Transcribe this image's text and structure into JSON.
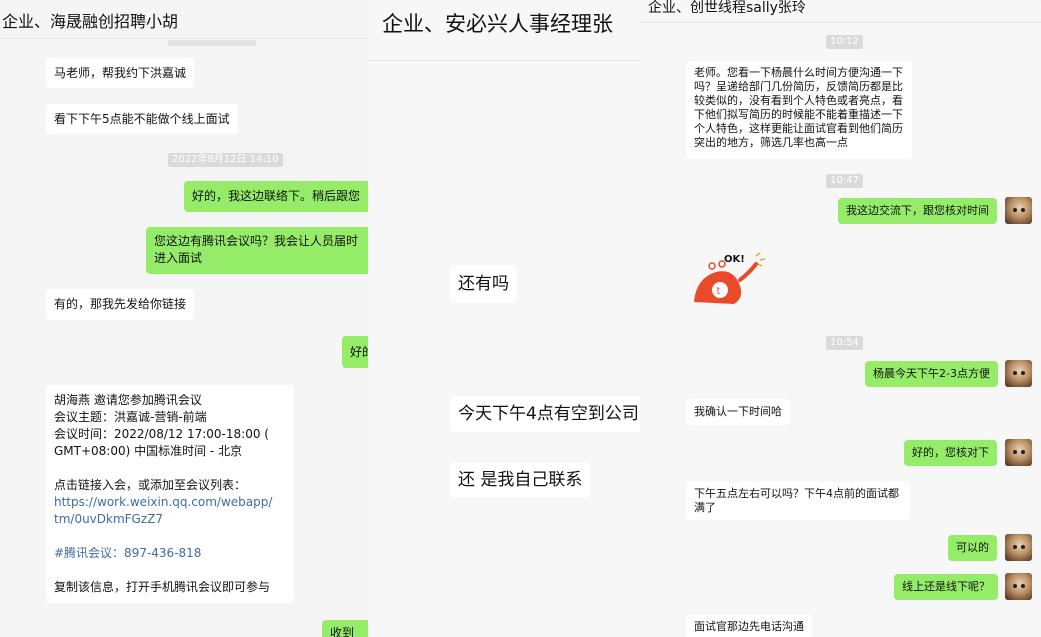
{
  "left_chat": {
    "title": "企业、海晟融创招聘小胡",
    "messages": [
      {
        "text": "马老师，帮我约下洪嘉诚"
      },
      {
        "text": "看下下午5点能不能做个线上面试"
      },
      {
        "timestamp": "2022年8月12日 14:10"
      },
      {
        "text": "好的，我这边联络下。稍后跟您"
      },
      {
        "line1": "您这边有腾讯会议吗？我会让人员届时",
        "line2": "进入面试"
      },
      {
        "text": "有的，那我先发给你链接"
      },
      {
        "text": "好的"
      },
      {
        "invite": "胡海燕 邀请您参加腾讯会议",
        "topic": "会议主题：洪嘉诚-营销-前端",
        "time1": "会议时间：2022/08/12 17:00-18:00 (",
        "time2": "GMT+08:00) 中国标准时间 - 北京",
        "join": "点击链接入会，或添加至会议列表：",
        "link1": "https://work.weixin.qq.com/webapp/",
        "link2": "tm/0uvDkmFGzZ7",
        "meeting_id": "#腾讯会议：897-436-818",
        "copy": "复制该信息，打开手机腾讯会议即可参与"
      },
      {
        "text": "收到"
      }
    ]
  },
  "middle_chat": {
    "title": "企业、安必兴人事经理张",
    "messages": [
      {
        "text": "还有吗"
      },
      {
        "text": "今天下午4点有空到公司"
      },
      {
        "text": "还 是我自己联系"
      }
    ]
  },
  "right_chat": {
    "title": "企业、创世线程sally张玲",
    "messages": [
      {
        "timestamp": "10:12"
      },
      {
        "lines": [
          "老师。您看一下杨晨什么时间方便沟通一下",
          "吗？呈递给部门几份简历，反馈简历都是比",
          "较类似的，没有看到个人特色或者亮点，看",
          "下他们拟写简历的时候能不能着重描述一下",
          "个人特色，这样更能让面试官看到他们简历",
          "突出的地方，筛选几率也高一点"
        ]
      },
      {
        "timestamp": "10:47"
      },
      {
        "text": "我这边交流下，跟您核对时间"
      },
      {
        "sticker": "OK!"
      },
      {
        "timestamp": "10:54"
      },
      {
        "text": "杨晨今天下午2-3点方便"
      },
      {
        "text": "我确认一下时间哈"
      },
      {
        "text": "好的，您核对下"
      },
      {
        "line1": "下午五点左右可以吗？下午4点前的面试都",
        "line2": "满了"
      },
      {
        "text": "可以的"
      },
      {
        "text": "线上还是线下呢？"
      },
      {
        "text": "面试官那边先电话沟通"
      }
    ]
  },
  "colors": {
    "outgoing": "#95ec69",
    "incoming": "#ffffff",
    "link": "#3e6ca7"
  }
}
